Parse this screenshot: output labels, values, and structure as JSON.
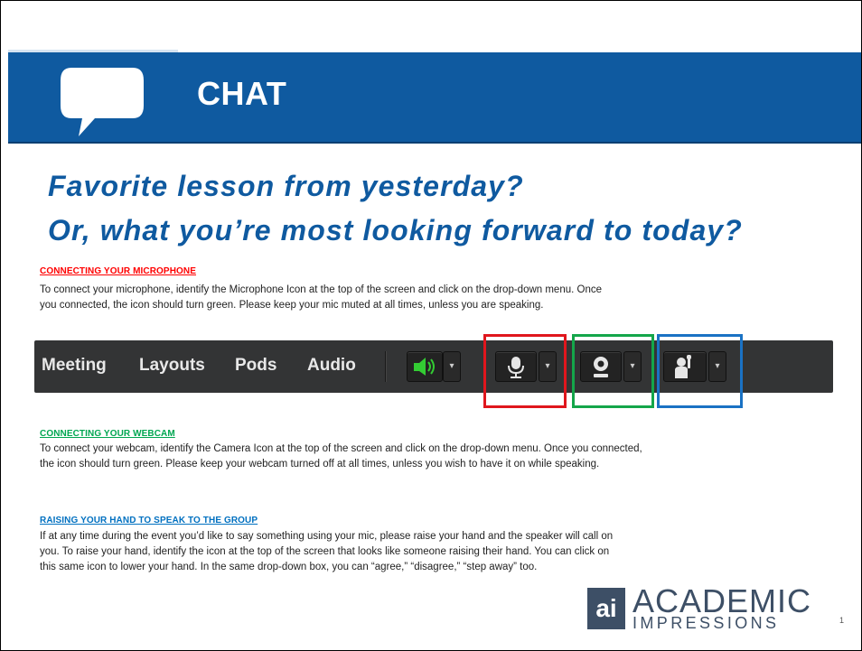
{
  "title": "CHAT",
  "questions": [
    "Favorite lesson from yesterday?",
    "Or, what you’re most looking forward to today?"
  ],
  "sections": {
    "microphone": {
      "heading": "CONNECTING YOUR MICROPHONE ",
      "color": "#ff0000",
      "lines": [
        "To connect your microphone, identify the Microphone Icon at the top of the screen and click on the drop-down menu. Once",
        "you connected, the icon should turn green.  Please keep your mic muted at all times, unless you are speaking."
      ]
    },
    "webcam": {
      "heading": "CONNECTING YOUR WEBCAM",
      "color": "#00a651",
      "lines": [
        "To connect your webcam, identify the Camera Icon at the top of the screen and click on the drop-down menu.  Once you connected,",
        "the icon should turn green.  Please keep your webcam turned off at all times, unless you wish to have it on while speaking."
      ]
    },
    "raise_hand": {
      "heading": "RAISING YOUR HAND TO SPEAK TO THE GROUP",
      "color": "#0070c0",
      "lines": [
        "If at any time during the event you’d like to say something using your mic, please raise your hand and the speaker will call on",
        "you.  To raise your hand, identify the icon at the top of the screen that looks like someone raising their hand.  You can click on",
        "this same icon to lower your hand.  In the same drop-down box, you can “agree,” “disagree,” “step away” too."
      ]
    }
  },
  "toolbar": {
    "menu": [
      "Meeting",
      "Layouts",
      "Pods",
      "Audio"
    ],
    "icons": [
      "speaker-icon",
      "microphone-icon",
      "webcam-icon",
      "raise-hand-icon"
    ],
    "dropdown_glyph": "▾"
  },
  "highlights": {
    "microphone": "#e0161d",
    "webcam": "#14a64a",
    "raise_hand": "#1a72c4"
  },
  "logo": {
    "mark": "ai",
    "line1": "ACADEMIC",
    "line2": "IMPRESSIONS"
  },
  "page_number": "1",
  "colors": {
    "brand_blue": "#0f5aa0",
    "speaker_green": "#33cc33"
  }
}
